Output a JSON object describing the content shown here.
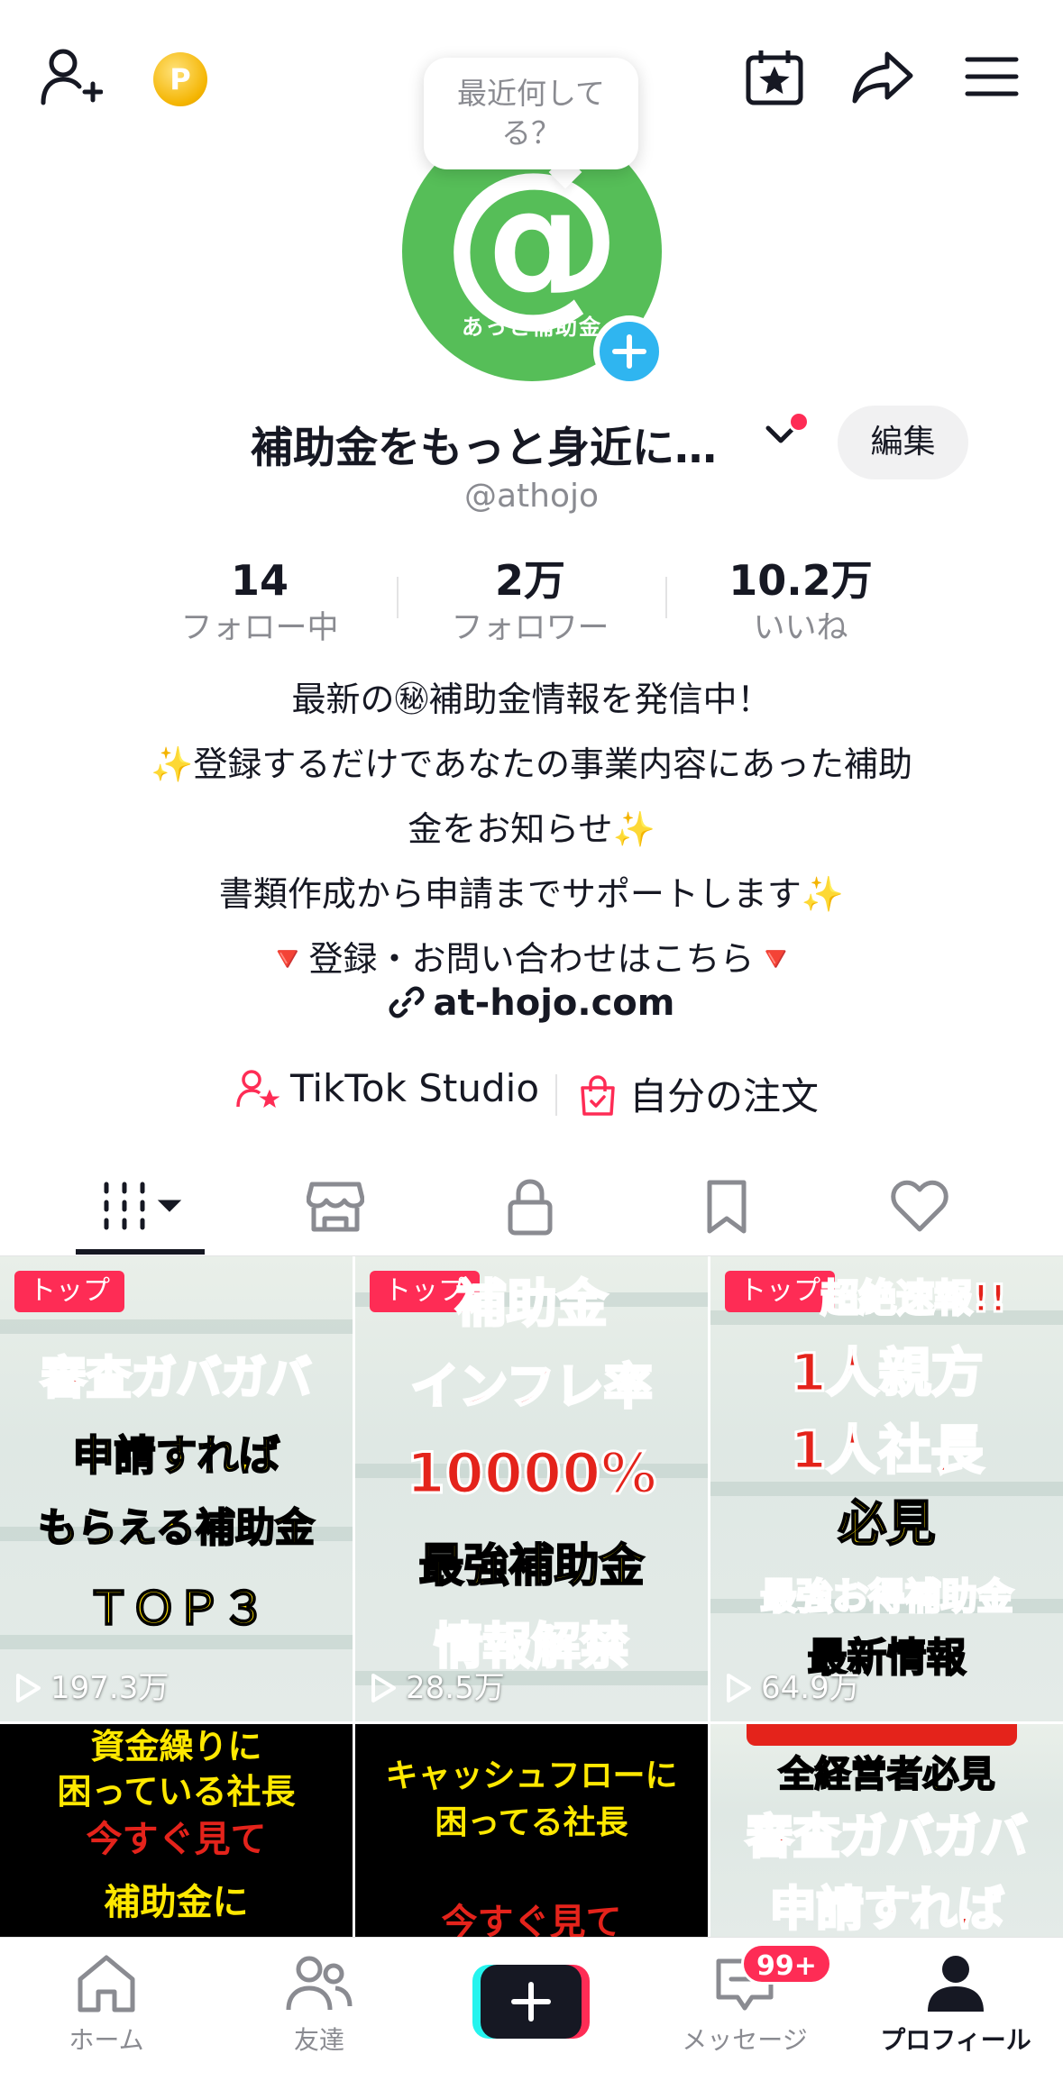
{
  "profile": {
    "status_prompt": "最近何して\nる？",
    "avatar_brand": "あっと補助金",
    "display_name": "補助金をもっと身近に…",
    "username": "@athojo",
    "edit_label": "編集"
  },
  "stats": [
    {
      "value": "14",
      "label": "フォロー中"
    },
    {
      "value": "2万",
      "label": "フォロワー"
    },
    {
      "value": "10.2万",
      "label": "いいね"
    }
  ],
  "bio": [
    "最新の㊙補助金情報を発信中！",
    "✨登録するだけであなたの事業内容にあった補助",
    "金をお知らせ✨",
    "書類作成から申請までサポートします✨",
    "🔻登録・お問い合わせはこちら🔻"
  ],
  "link": "at-hojo.com",
  "actions": {
    "studio": "TikTok Studio",
    "orders": "自分の注文"
  },
  "tabs": [
    "videos",
    "shop",
    "private",
    "saved",
    "liked"
  ],
  "videos": [
    {
      "badge": "トップ",
      "views": "197.3万",
      "lines": [
        "審査ガバガバ",
        "申請すれば",
        "もらえる補助金",
        "ＴＯＰ３"
      ]
    },
    {
      "badge": "トップ",
      "views": "28.5万",
      "lines": [
        "補助金",
        "インフレ率",
        "10000%",
        "最強補助金",
        "情報解禁"
      ]
    },
    {
      "badge": "トップ",
      "views": "64.9万",
      "lines": [
        "超絶速報!!",
        "1人親方",
        "1人社長",
        "必見",
        "最強お得補助金",
        "最新情報"
      ]
    },
    {
      "lines": [
        "資金繰りに",
        "困っている社長",
        "今すぐ見て",
        "補助金に"
      ]
    },
    {
      "lines": [
        "キャッシュフローに",
        "困ってる社長",
        "今すぐ見て"
      ]
    },
    {
      "lines": [
        "全経営者必見",
        "審査ガバガバ",
        "申請すれば"
      ]
    }
  ],
  "nav": {
    "home": "ホーム",
    "friends": "友達",
    "inbox": "メッセージ",
    "inbox_badge": "99+",
    "profile": "プロフィール"
  },
  "colors": {
    "accent": "#fe2c55",
    "avatar_bg": "#56be58",
    "add_badge": "#2fb5f0"
  }
}
